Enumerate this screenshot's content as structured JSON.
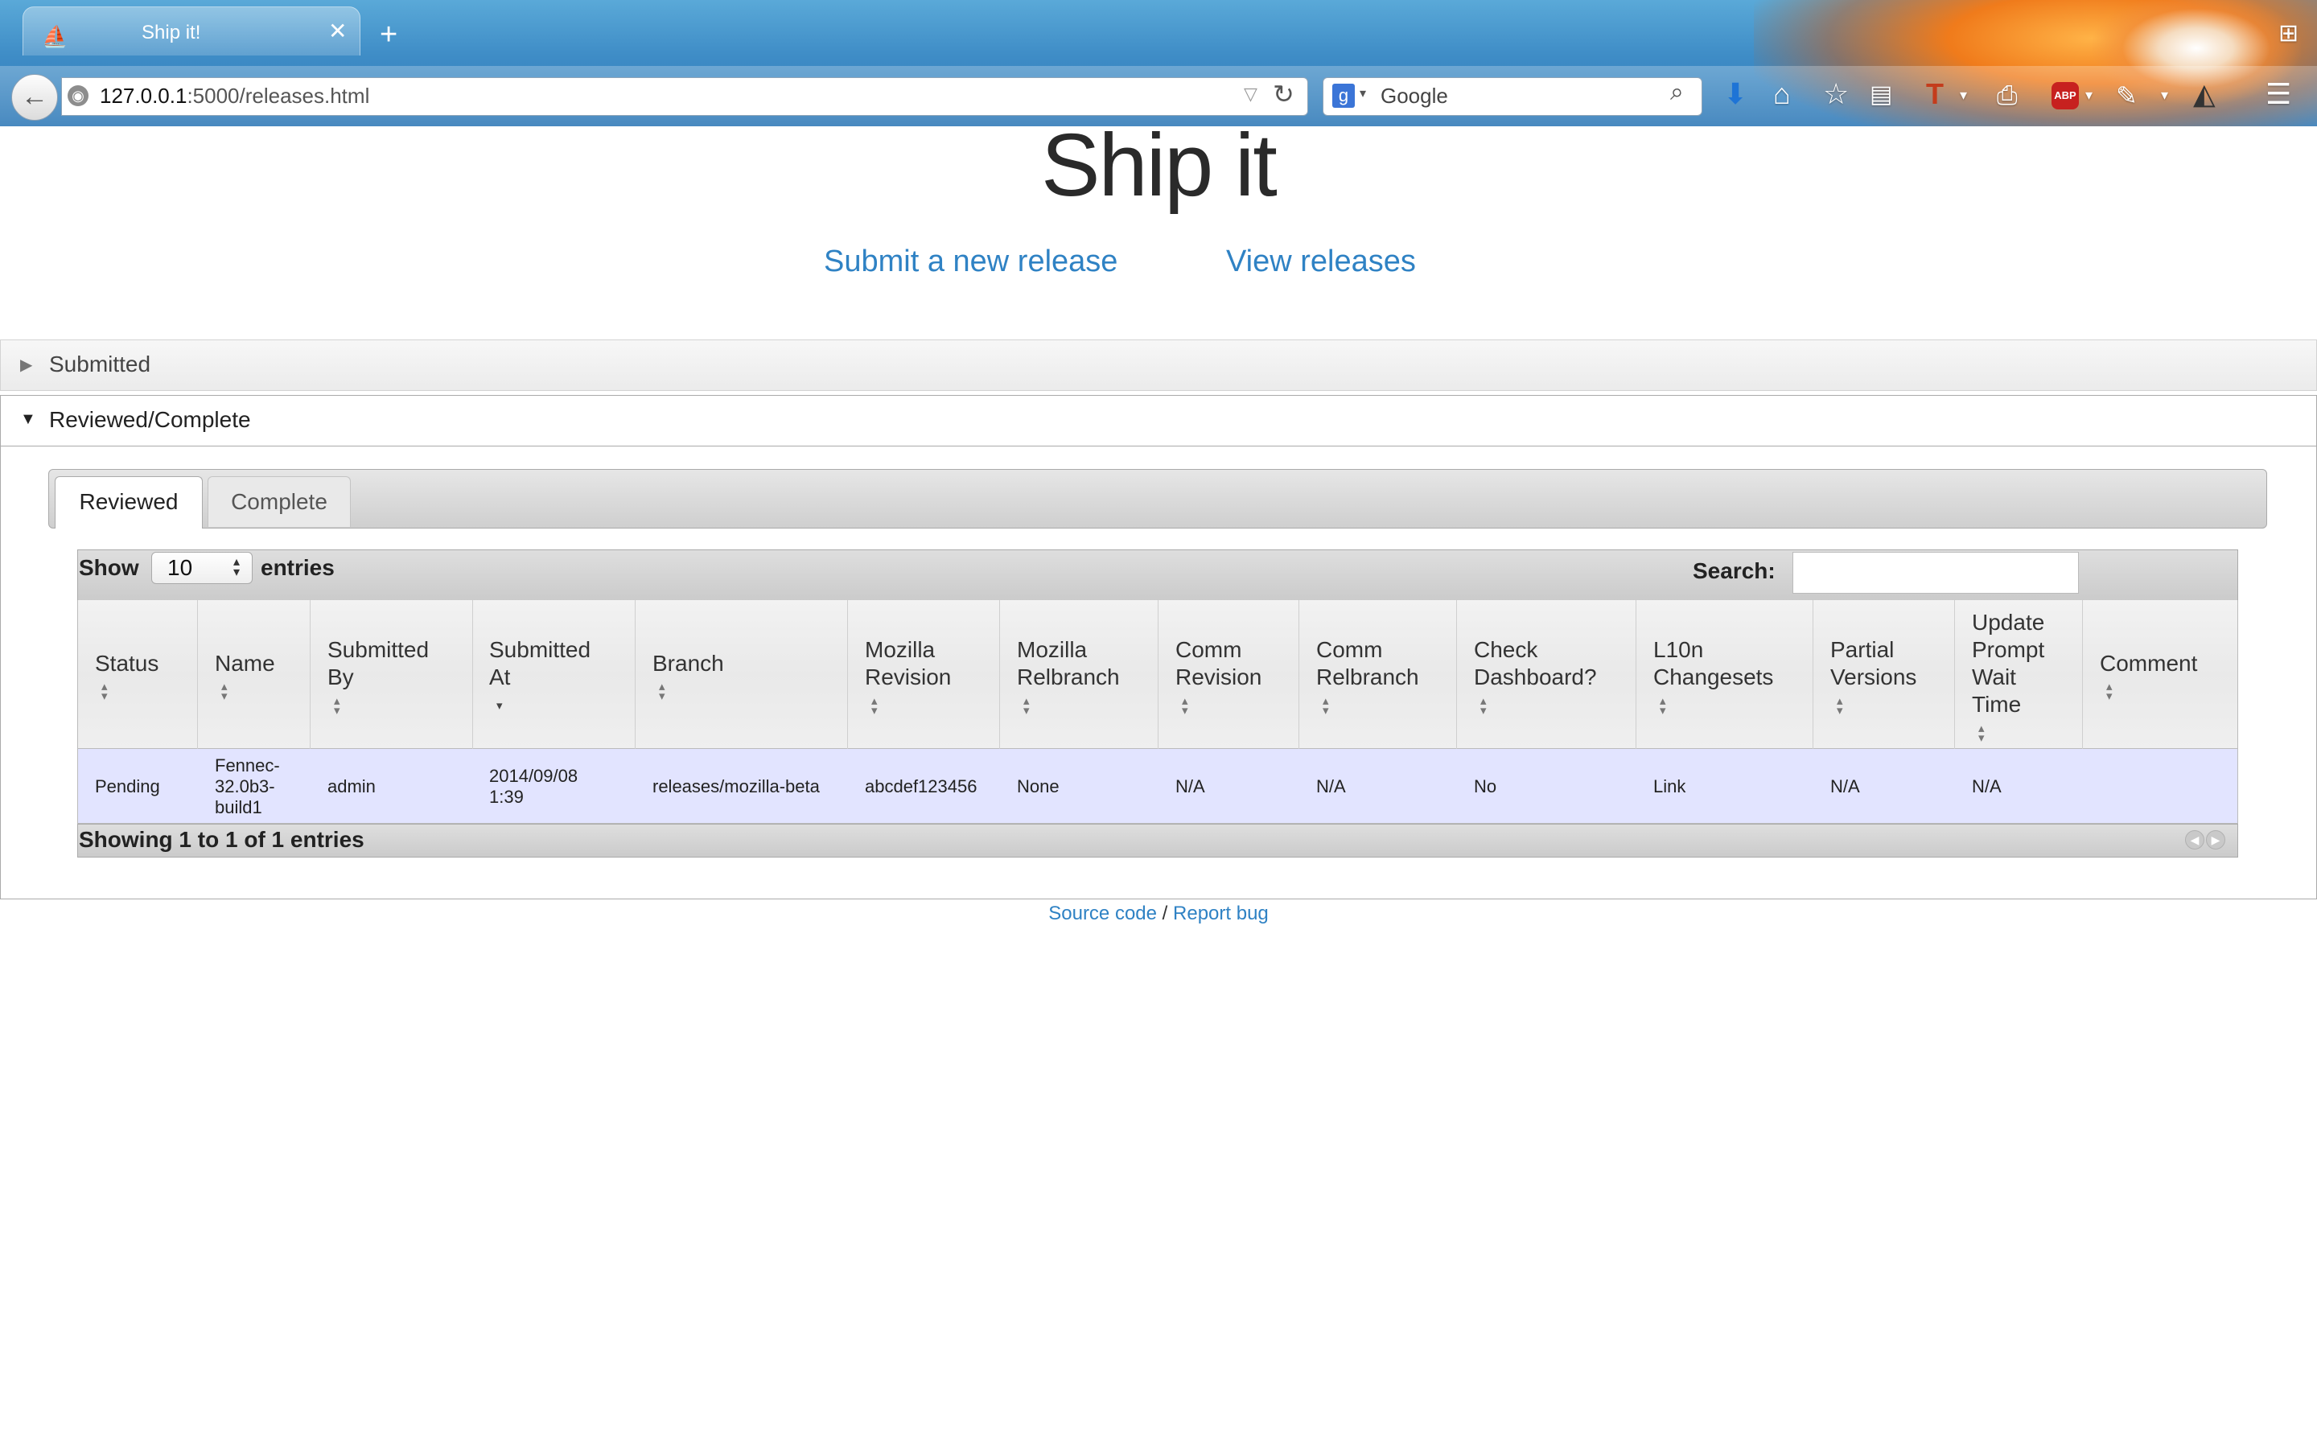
{
  "browser": {
    "tab_title": "Ship it!",
    "url_host": "127.0.0.1",
    "url_rest": ":5000/releases.html",
    "search_placeholder": "Google",
    "icons": [
      "back-icon",
      "reload-icon",
      "download-icon",
      "home-icon",
      "bookmark-star-icon",
      "reading-list-icon",
      "addon-icon",
      "print-icon",
      "adblock-icon",
      "tools-icon",
      "sync-icon",
      "menu-icon"
    ]
  },
  "page": {
    "title": "Ship it",
    "nav": {
      "submit": "Submit a new release",
      "view": "View releases"
    }
  },
  "accordion": {
    "submitted": "Submitted",
    "reviewed_complete": "Reviewed/Complete"
  },
  "tabs": {
    "reviewed": "Reviewed",
    "complete": "Complete"
  },
  "datatable": {
    "show_label": "Show",
    "entries_label": "entries",
    "length_value": "10",
    "search_label": "Search:",
    "info": "Showing 1 to 1 of 1 entries",
    "columns": [
      [
        "Status"
      ],
      [
        "Name"
      ],
      [
        "Submitted",
        "By"
      ],
      [
        "Submitted",
        "At"
      ],
      [
        "Branch"
      ],
      [
        "Mozilla",
        "Revision"
      ],
      [
        "Mozilla",
        "Relbranch"
      ],
      [
        "Comm",
        "Revision"
      ],
      [
        "Comm",
        "Relbranch"
      ],
      [
        "Check",
        "Dashboard?"
      ],
      [
        "L10n",
        "Changesets"
      ],
      [
        "Partial",
        "Versions"
      ],
      [
        "Update",
        "Prompt",
        "Wait",
        "Time"
      ],
      [
        "Comment"
      ]
    ],
    "rows": [
      {
        "status": "Pending",
        "name": [
          "Fennec-",
          "32.0b3-",
          "build1"
        ],
        "submitted_by": "admin",
        "submitted_at": [
          "2014/09/08",
          "1:39"
        ],
        "branch": "releases/mozilla-beta",
        "mozilla_revision": "abcdef123456",
        "mozilla_relbranch": "None",
        "comm_revision": "N/A",
        "comm_relbranch": "N/A",
        "check_dashboard": "No",
        "l10n_changesets": "Link",
        "partial_versions": "N/A",
        "update_prompt_wait_time": "N/A",
        "comment": ""
      }
    ]
  },
  "footer": {
    "source": "Source code",
    "sep": "/",
    "bug": "Report bug"
  },
  "colors": {
    "link": "#2f82c4",
    "row_highlight": "#e2e4ff",
    "chrome_blue": "#3e8cc6"
  }
}
